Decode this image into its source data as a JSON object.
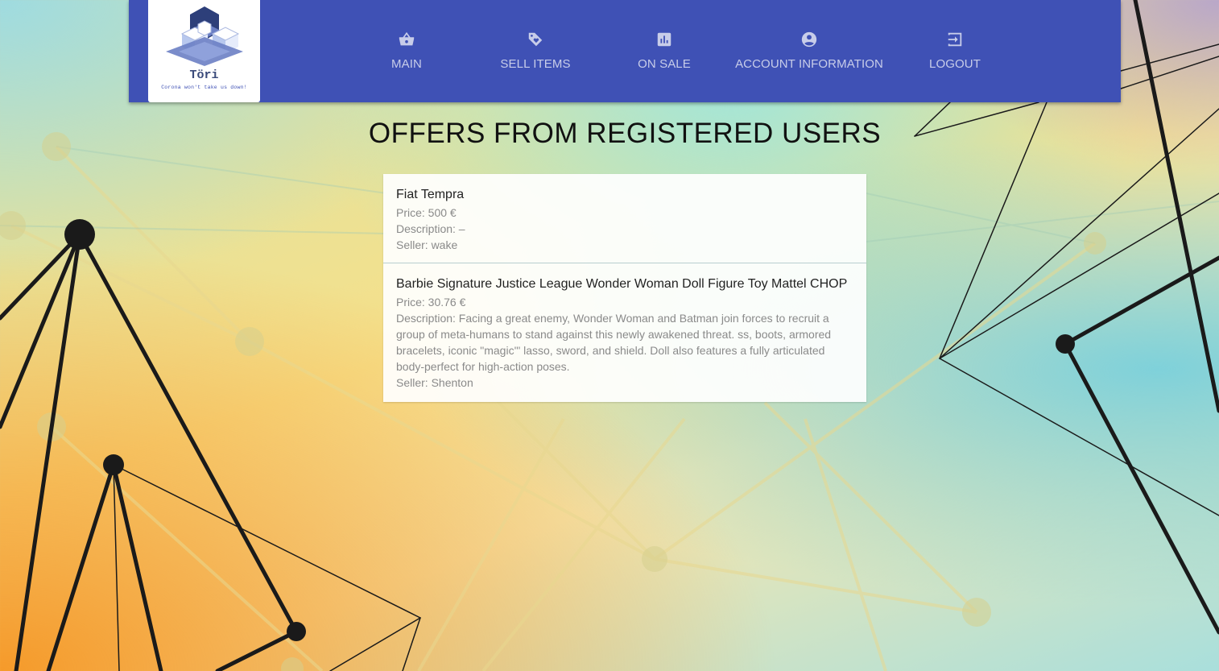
{
  "logo": {
    "title": "Töri",
    "subtitle": "Corona won't take us down!"
  },
  "nav": {
    "items": [
      {
        "label": "MAIN",
        "icon": "basket-icon"
      },
      {
        "label": "SELL ITEMS",
        "icon": "tag-icon"
      },
      {
        "label": "ON SALE",
        "icon": "chart-icon"
      },
      {
        "label": "ACCOUNT INFORMATION",
        "icon": "account-circle-icon"
      },
      {
        "label": "LOGOUT",
        "icon": "logout-icon"
      }
    ]
  },
  "page_title": "OFFERS FROM REGISTERED USERS",
  "offers": [
    {
      "name": "Fiat Tempra",
      "price": "Price: 500 €",
      "description": "Description: –",
      "seller": "Seller: wake"
    },
    {
      "name": "Barbie Signature Justice League Wonder Woman Doll Figure Toy Mattel CHOP",
      "price": "Price: 30.76 €",
      "description": "Description: Facing a great enemy, Wonder Woman and Batman join forces to recruit a group of meta-humans to stand against this newly awakened threat. ss, boots, armored bracelets, iconic \"magic'\" lasso, sword, and shield. Doll also features a fully articulated body-perfect for high-action poses.",
      "seller": "Seller: Shenton"
    }
  ],
  "colors": {
    "navbar": "#3f51b5",
    "nav_text": "#c8cde9"
  }
}
